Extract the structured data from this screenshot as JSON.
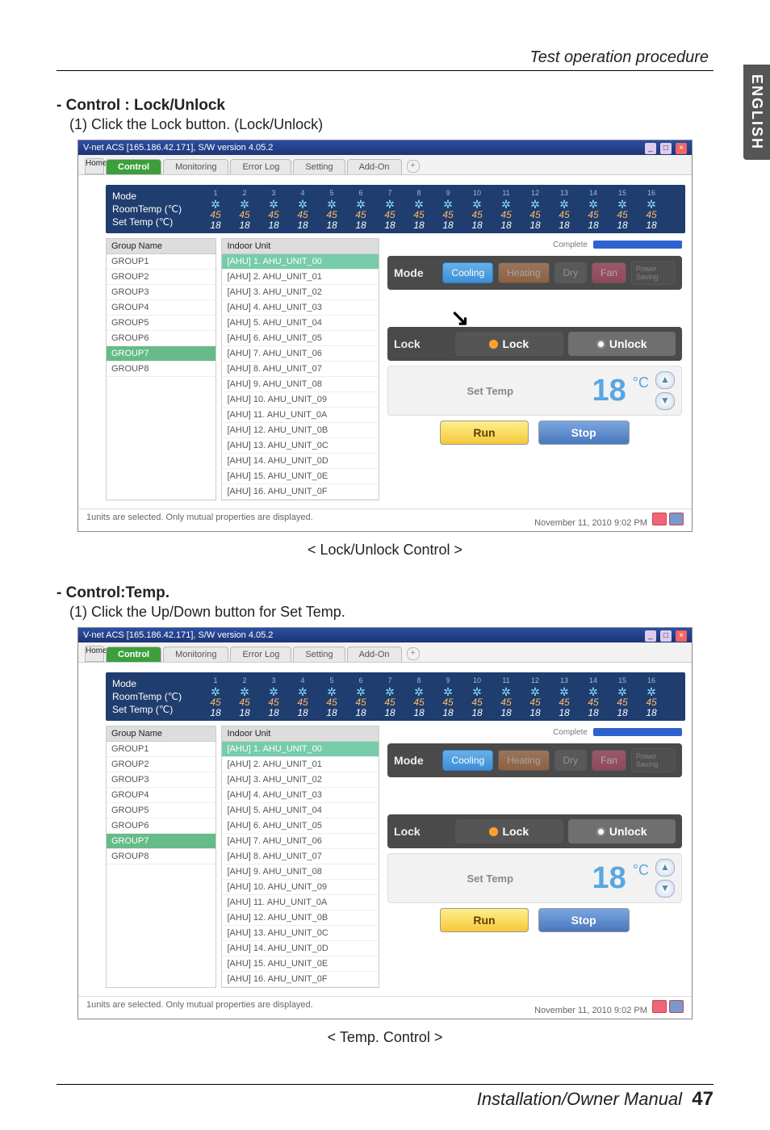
{
  "page_header": "Test operation procedure",
  "side_tab": "ENGLISH",
  "section1": {
    "title": "- Control : Lock/Unlock",
    "sub": "(1) Click the Lock button. (Lock/Unlock)",
    "caption": "< Lock/Unlock Control >"
  },
  "section2": {
    "title": "- Control:Temp.",
    "sub": "(1) Click the Up/Down button for Set Temp.",
    "caption": "< Temp. Control >"
  },
  "footer": {
    "text": "Installation/Owner Manual",
    "page": "47"
  },
  "app": {
    "title": "V-net ACS [165.186.42.171],   S/W version 4.05.2",
    "tabs": {
      "home": "Home",
      "control": "Control",
      "monitoring": "Monitoring",
      "errorlog": "Error Log",
      "setting": "Setting",
      "addon": "Add-On"
    },
    "status_labels": {
      "mode": "Mode",
      "roomtemp": "RoomTemp (℃)",
      "settemp": "Set Temp  (℃)"
    },
    "unit_columns": {
      "count": 16,
      "value45": "45",
      "value18": "18"
    },
    "group_header": "Group Name",
    "groups": [
      "GROUP1",
      "GROUP2",
      "GROUP3",
      "GROUP4",
      "GROUP5",
      "GROUP6",
      "GROUP7",
      "GROUP8"
    ],
    "selected_group_index": 6,
    "indoor_header": "Indoor Unit",
    "units": [
      "[AHU] 1. AHU_UNIT_00",
      "[AHU] 2. AHU_UNIT_01",
      "[AHU] 3. AHU_UNIT_02",
      "[AHU] 4. AHU_UNIT_03",
      "[AHU] 5. AHU_UNIT_04",
      "[AHU] 6. AHU_UNIT_05",
      "[AHU] 7. AHU_UNIT_06",
      "[AHU] 8. AHU_UNIT_07",
      "[AHU] 9. AHU_UNIT_08",
      "[AHU] 10. AHU_UNIT_09",
      "[AHU] 11. AHU_UNIT_0A",
      "[AHU] 12. AHU_UNIT_0B",
      "[AHU] 13. AHU_UNIT_0C",
      "[AHU] 14. AHU_UNIT_0D",
      "[AHU] 15. AHU_UNIT_0E",
      "[AHU] 16. AHU_UNIT_0F"
    ],
    "selected_unit_index": 0,
    "complete": "Complete",
    "mode_row": {
      "label": "Mode",
      "cooling": "Cooling",
      "heating": "Heating",
      "dry": "Dry",
      "fan": "Fan",
      "power": "Power Saving"
    },
    "lock_row": {
      "label": "Lock",
      "lock": "Lock",
      "unlock": "Unlock"
    },
    "settemp": {
      "label": "Set Temp",
      "value": "18",
      "unit": "°C"
    },
    "run": "Run",
    "stop": "Stop",
    "statusbar": {
      "left": "1units are selected. Only mutual properties are displayed.",
      "right": "November 11, 2010  9:02 PM"
    }
  }
}
